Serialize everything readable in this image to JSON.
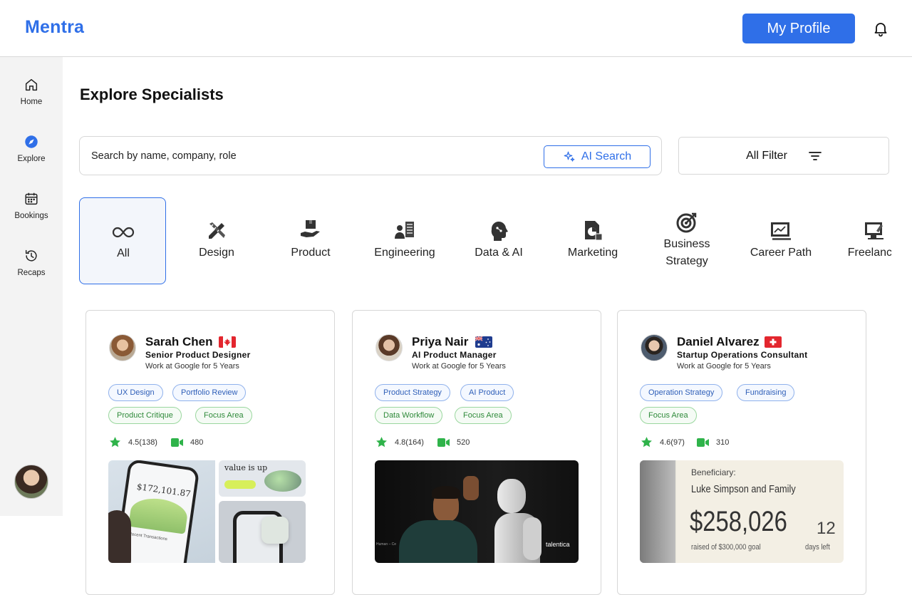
{
  "app": {
    "logo": "Mentra"
  },
  "header": {
    "profile_label": "My Profile",
    "bell_icon": "bell-icon"
  },
  "sidebar": {
    "items": [
      {
        "label": "Home",
        "icon": "home-icon"
      },
      {
        "label": "Explore",
        "icon": "compass-icon"
      },
      {
        "label": "Bookings",
        "icon": "calendar-icon"
      },
      {
        "label": "Recaps",
        "icon": "history-icon"
      }
    ],
    "active": "Explore"
  },
  "main": {
    "title": "Explore Specialists",
    "search": {
      "placeholder": "Search by name, company, role",
      "ai_label": "AI Search"
    },
    "filter_label": "All Filter",
    "categories": [
      {
        "label": "All",
        "icon": "infinity-icon"
      },
      {
        "label": "Design",
        "icon": "pencil-ruler-icon"
      },
      {
        "label": "Product",
        "icon": "box-hand-icon"
      },
      {
        "label": "Engineering",
        "icon": "engineer-icon"
      },
      {
        "label": "Data & AI",
        "icon": "ai-head-icon"
      },
      {
        "label": "Marketing",
        "icon": "document-chart-icon"
      },
      {
        "label": "Business Strategy",
        "label_lines": [
          "Business",
          "Strategy"
        ],
        "icon": "target-icon"
      },
      {
        "label": "Career Path",
        "icon": "presentation-icon"
      },
      {
        "label": "Freelancer",
        "icon": "workspace-icon"
      }
    ],
    "specialists": [
      {
        "name": "Sarah Chen",
        "flag": "canada-flag-icon",
        "role": "Senior Product Designer",
        "work": "Work at Google for 5 Years",
        "tags": [
          {
            "label": "UX Design",
            "color": "blue"
          },
          {
            "label": "Portfolio Review",
            "color": "blue"
          },
          {
            "label": "Product Critique",
            "color": "green"
          },
          {
            "label": "Focus Area",
            "color": "green"
          }
        ],
        "rating": "4.5(138)",
        "sessions": "480",
        "preview": {
          "value_text": "value is up",
          "amount": "$172,101.87",
          "list_title": "Recent Transactions"
        }
      },
      {
        "name": "Priya Nair",
        "flag": "australia-flag-icon",
        "role": "AI Product Manager",
        "work": "Work at Google for 5 Years",
        "tags": [
          {
            "label": "Product Strategy",
            "color": "blue"
          },
          {
            "label": "AI Product",
            "color": "blue"
          },
          {
            "label": "Data Workflow",
            "color": "green"
          },
          {
            "label": "Focus Area",
            "color": "green"
          }
        ],
        "rating": "4.8(164)",
        "sessions": "520",
        "preview": {
          "brand": "talentica",
          "caption": "Human – Ce"
        }
      },
      {
        "name": "Daniel Alvarez",
        "flag": "switzerland-flag-icon",
        "role": "Startup Operations Consultant",
        "work": "Work at Google for 5 Years",
        "tags": [
          {
            "label": "Operation Strategy",
            "color": "blue"
          },
          {
            "label": "Fundraising",
            "color": "blue"
          },
          {
            "label": "Focus Area",
            "color": "green"
          }
        ],
        "rating": "4.6(97)",
        "sessions": "310",
        "preview": {
          "beneficiary_label": "Beneficiary:",
          "beneficiary": "Luke Simpson and Family",
          "amount": "$258,026",
          "goal": "raised of $300,000 goal",
          "days": "12",
          "days_label": "days left"
        }
      }
    ]
  },
  "colors": {
    "accent": "#2f6fe8",
    "tag_blue": "#2f5fb8",
    "tag_green": "#2f8a3a",
    "star": "#2fb34a"
  }
}
